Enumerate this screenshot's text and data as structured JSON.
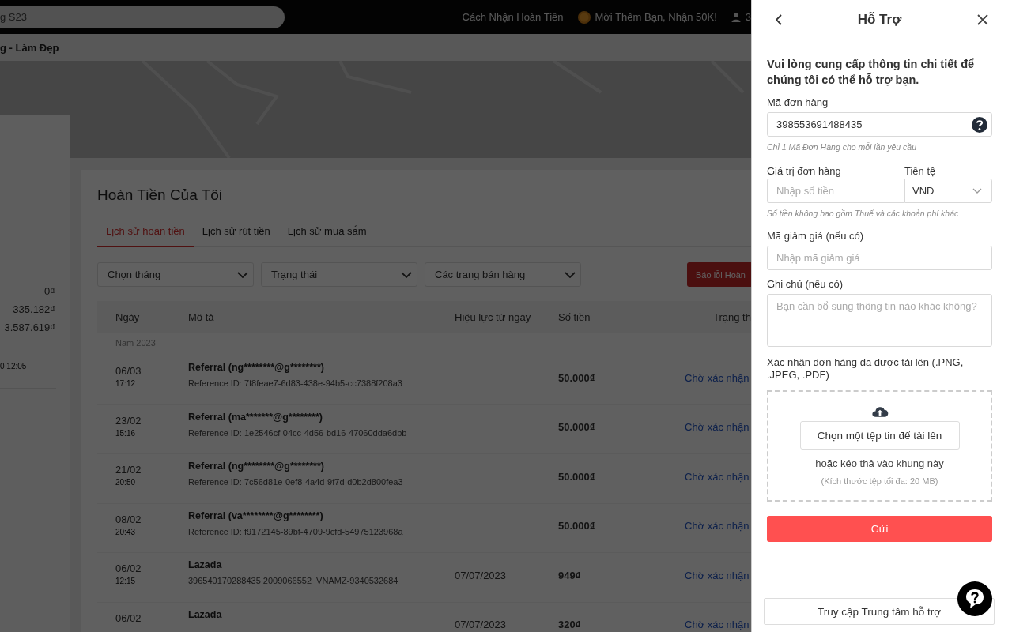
{
  "top_bar": {
    "search": {
      "placeholder": "g S23"
    },
    "links": [
      {
        "label": "Cách Nhận Hoàn Tiền",
        "kind": "plain"
      },
      {
        "label": "Mời Thêm Bạn, Nhận 50K!",
        "kind": "coin"
      }
    ],
    "user_count": "3"
  },
  "breadcrumb": "g - Làm Đẹp",
  "summary": {
    "values": [
      "0₫",
      "335.182₫",
      "3.587.619₫"
    ],
    "updated": "0 12:05"
  },
  "main": {
    "title": "Hoàn Tiền Của Tôi",
    "tabs": [
      {
        "label": "Lịch sử hoàn tiền",
        "selected": true
      },
      {
        "label": "Lịch sử rút tiền",
        "selected": false
      },
      {
        "label": "Lịch sử mua sắm",
        "selected": false
      }
    ],
    "filters": [
      "Chọn tháng",
      "Trạng thái",
      "Các trang bán hàng"
    ],
    "report_button": "Báo lỗi Hoàn",
    "columns": [
      "Ngày",
      "Mô tả",
      "Hiệu lực từ ngày",
      "Số tiền",
      "Trạng th"
    ],
    "year": "Năm 2023",
    "rows": [
      {
        "date": "06/03",
        "time": "17:12",
        "title": "Referral (ng********@g********)",
        "detail": "Reference ID: 7f8feae7-6d83-438e-94b5-cc7388f208a3",
        "valid_from": "",
        "amount": "50.000₫",
        "status": "Chờ xác nhận"
      },
      {
        "date": "23/02",
        "time": "15:16",
        "title": "Referral (ma*******@g********)",
        "detail": "Reference ID: 1e2546cf-04cc-4d56-bd16-47060dda6dbb",
        "valid_from": "",
        "amount": "50.000₫",
        "status": "Chờ xác nhận"
      },
      {
        "date": "21/02",
        "time": "20:50",
        "title": "Referral (ng********@g********)",
        "detail": "Reference ID: 7c56d81e-0ef8-4a4d-9f7d-d0b2d800fea3",
        "valid_from": "",
        "amount": "50.000₫",
        "status": "Chờ xác nhận"
      },
      {
        "date": "08/02",
        "time": "20:43",
        "title": "Referral (va********@g********)",
        "detail": "Reference ID: f9172145-89bf-4709-9cfd-54975123968a",
        "valid_from": "",
        "amount": "50.000₫",
        "status": "Chờ xác nhận"
      },
      {
        "date": "06/02",
        "time": "12:15",
        "title": "Lazada",
        "detail": "396540170288435 2009066552_VNAMZ-9340532684",
        "valid_from": "07/07/2023",
        "amount": "949₫",
        "status": "Chờ xác nhận"
      },
      {
        "date": "06/02",
        "title": "Lazada",
        "valid_from": "07/07/2023",
        "amount": "320₫",
        "status": "Chờ xác nhận"
      }
    ]
  },
  "drawer": {
    "title": "Hỗ Trợ",
    "intro": "Vui lòng cung cấp thông tin chi tiết để chúng tôi có thể hỗ trợ bạn.",
    "order_id": {
      "label": "Mã đơn hàng",
      "value": "398553691488435",
      "hint": "Chỉ 1 Mã Đơn Hàng cho mỗi lần yêu cầu"
    },
    "order_value": {
      "label": "Giá trị đơn hàng",
      "placeholder": "Nhập số tiền"
    },
    "currency": {
      "label": "Tiền tệ",
      "value": "VND"
    },
    "value_hint": "Số tiền không bao gồm Thuế và các khoản phí khác",
    "coupon": {
      "label": "Mã giảm giá (nếu có)",
      "placeholder": "Nhập mã giảm giá"
    },
    "note": {
      "label": "Ghi chú (nếu có)",
      "placeholder": "Bạn cần bổ sung thông tin nào khác không?"
    },
    "upload": {
      "label": "Xác nhận đơn hàng đã được tải lên (.PNG, .JPEG, .PDF)",
      "button": "Chọn một tệp tin để tải lên",
      "drag_text": "hoặc kéo thả vào khung này",
      "size_note": "(Kích thước tệp tối đa: 20 MB)"
    },
    "submit": "Gửi",
    "help_center": "Truy cập Trung tâm hỗ trợ"
  }
}
